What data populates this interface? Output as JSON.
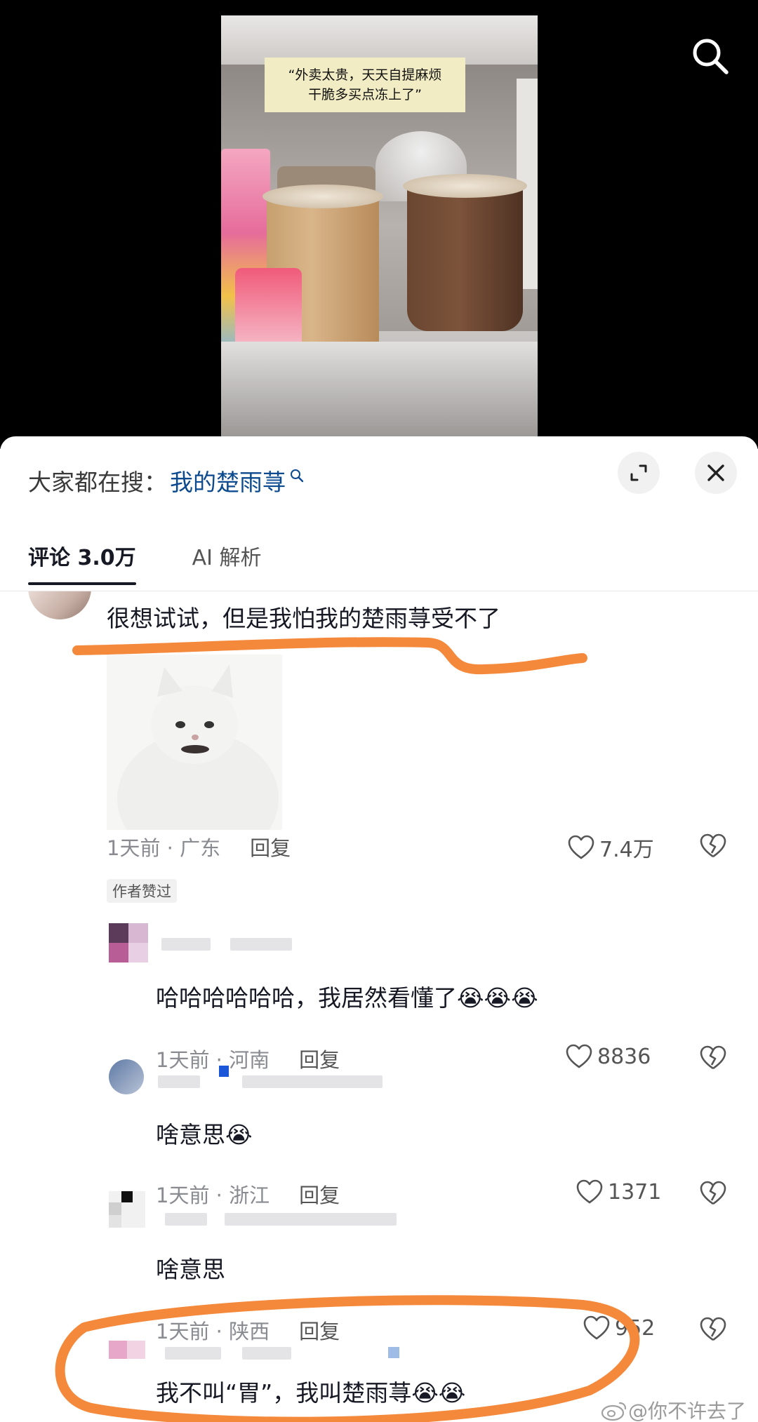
{
  "video": {
    "caption": "“外卖太贵，天天自提麻烦\n干脆多买点冻上了”"
  },
  "header": {
    "search_prefix": "大家都在搜：",
    "search_term": "我的楚雨荨"
  },
  "tabs": [
    {
      "label": "评论 3.0万",
      "active": true
    },
    {
      "label": "AI 解析",
      "active": false
    }
  ],
  "comments": [
    {
      "text": "很想试试，但是我怕我的楚雨荨受不了",
      "time": "1天前 · 广东",
      "reply_label": "回复",
      "likes": "7.4万",
      "badge": "作者赞过"
    },
    {
      "text": "哈哈哈哈哈哈，我居然看懂了",
      "emoji": "😭😭😭",
      "time": "1天前 · 河南",
      "reply_label": "回复",
      "likes": "8836"
    },
    {
      "text": "啥意思",
      "emoji": "😭",
      "time": "1天前 · 浙江",
      "reply_label": "回复",
      "likes": "1371"
    },
    {
      "text": "啥意思",
      "time": "1天前 · 陕西",
      "reply_label": "回复",
      "likes": "952"
    },
    {
      "text": "我不叫“胃”，我叫楚雨荨",
      "emoji": "😭😭"
    }
  ],
  "watermark": "@你不许去了",
  "colors": {
    "annotation": "#f5893b",
    "search_term": "#0c4a8f",
    "badge_bg": "#f1f1f2"
  },
  "icons": [
    "search-icon",
    "expand-icon",
    "close-icon",
    "heart-icon",
    "broken-heart-icon",
    "weibo-icon"
  ]
}
